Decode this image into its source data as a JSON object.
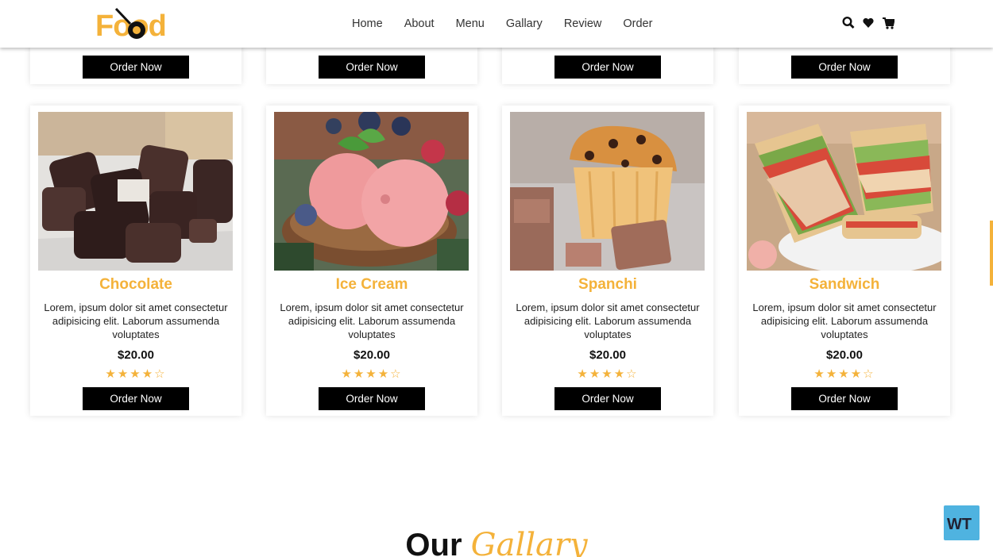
{
  "header": {
    "logo_text": "Food",
    "nav": [
      "Home",
      "About",
      "Menu",
      "Gallary",
      "Review",
      "Order"
    ],
    "icons": [
      "search-icon",
      "heart-icon",
      "cart-icon"
    ]
  },
  "top_cards": [
    {
      "button": "Order Now"
    },
    {
      "button": "Order Now"
    },
    {
      "button": "Order Now"
    },
    {
      "button": "Order Now"
    }
  ],
  "cards": [
    {
      "title": "Chocolate",
      "desc": "Lorem, ipsum dolor sit amet consectetur adipisicing elit. Laborum assumenda voluptates",
      "price": "$20.00",
      "rating": "4.5 of 5",
      "button": "Order Now"
    },
    {
      "title": "Ice Cream",
      "desc": "Lorem, ipsum dolor sit amet consectetur adipisicing elit. Laborum assumenda voluptates",
      "price": "$20.00",
      "rating": "4.5 of 5",
      "button": "Order Now"
    },
    {
      "title": "Spanchi",
      "desc": "Lorem, ipsum dolor sit amet consectetur adipisicing elit. Laborum assumenda voluptates",
      "price": "$20.00",
      "rating": "4.5 of 5",
      "button": "Order Now"
    },
    {
      "title": "Sandwich",
      "desc": "Lorem, ipsum dolor sit amet consectetur adipisicing elit. Laborum assumenda voluptates",
      "price": "$20.00",
      "rating": "4.5 of 5",
      "button": "Order Now"
    }
  ],
  "gallery": {
    "word1": "Our",
    "word2": "Gallary"
  },
  "badge": {
    "text": "WT"
  },
  "colors": {
    "accent": "#f4b23a",
    "button": "#000000",
    "background": "#ffffff"
  }
}
